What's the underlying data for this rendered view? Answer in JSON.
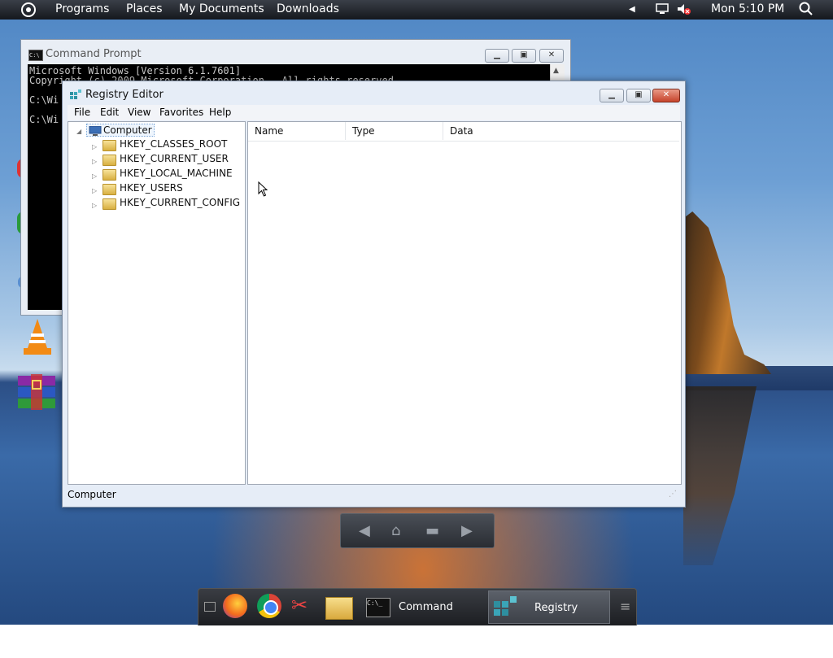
{
  "top_panel": {
    "menu": [
      "Programs",
      "Places",
      "My Documents",
      "Downloads"
    ],
    "clock": "Mon 5:10 PM"
  },
  "cmd_window": {
    "title": "Command Prompt",
    "lines": [
      "Microsoft Windows [Version 6.1.7601]",
      "Copyright (c) 2009 Microsoft Corporation.  All rights reserved.",
      "",
      "C:\\Wi",
      "",
      "C:\\Wi"
    ]
  },
  "registry_editor": {
    "title": "Registry Editor",
    "menu": [
      "File",
      "Edit",
      "View",
      "Favorites",
      "Help"
    ],
    "tree_root": "Computer",
    "tree_items": [
      "HKEY_CLASSES_ROOT",
      "HKEY_CURRENT_USER",
      "HKEY_LOCAL_MACHINE",
      "HKEY_USERS",
      "HKEY_CURRENT_CONFIG"
    ],
    "columns": [
      "Name",
      "Type",
      "Data"
    ],
    "status": "Computer"
  },
  "taskbar": {
    "tasks": [
      "Command Prompt",
      "Registry Editor"
    ]
  },
  "icons": {
    "menu": "menu-circle-icon",
    "volume": "volume-muted-icon",
    "search": "search-icon"
  },
  "colors": {
    "close_button": "#c6432b",
    "panel": "#15181d"
  }
}
